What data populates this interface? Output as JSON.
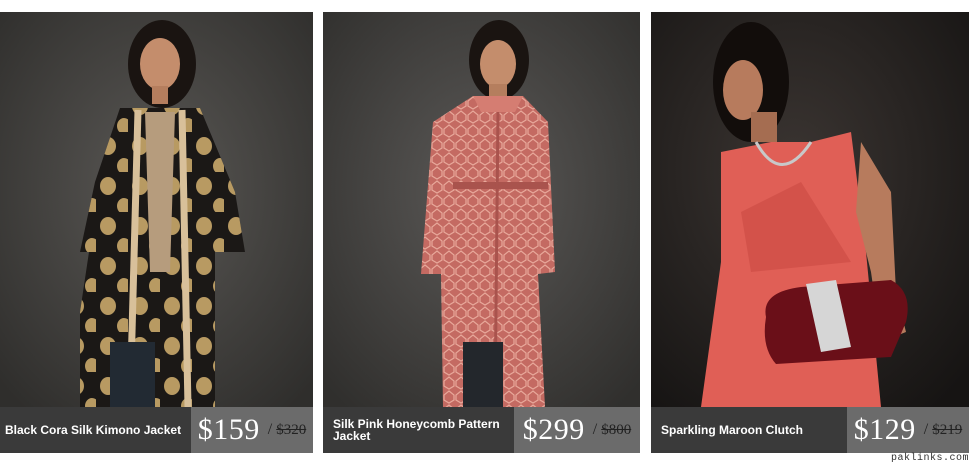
{
  "products": [
    {
      "name": "Black Cora Silk Kimono Jacket",
      "price": "$159",
      "old_price": "$320"
    },
    {
      "name": "Silk Pink Honeycomb Pattern Jacket",
      "price": "$299",
      "old_price": "$800"
    },
    {
      "name": "Sparkling Maroon Clutch",
      "price": "$129",
      "old_price": "$219"
    }
  ],
  "watermark": "paklinks.com",
  "colors": {
    "caption_bg": "#3a3a3a",
    "price_bg": "#6b6b6b",
    "card_bg": "#3b3a39"
  }
}
